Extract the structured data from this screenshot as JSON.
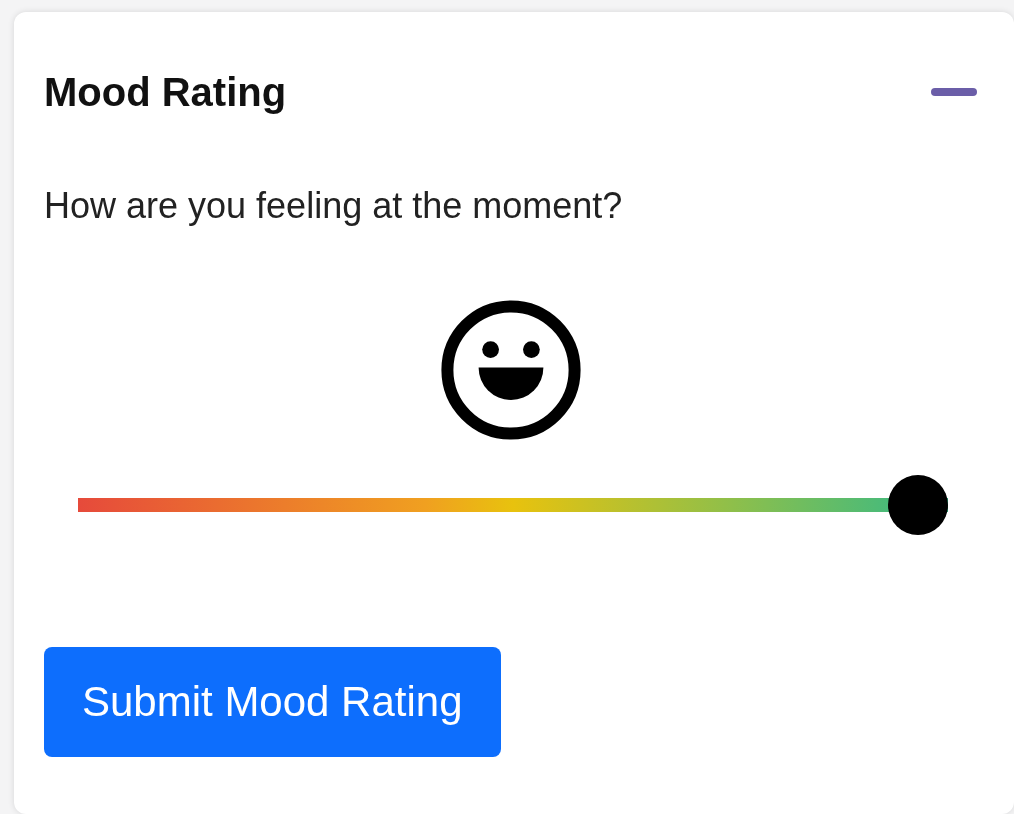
{
  "card": {
    "title": "Mood Rating",
    "expanded": true
  },
  "question": "How are you feeling at the moment?",
  "mood_slider": {
    "level": 1.0
  },
  "submit_button": "Submit Mood Rating"
}
